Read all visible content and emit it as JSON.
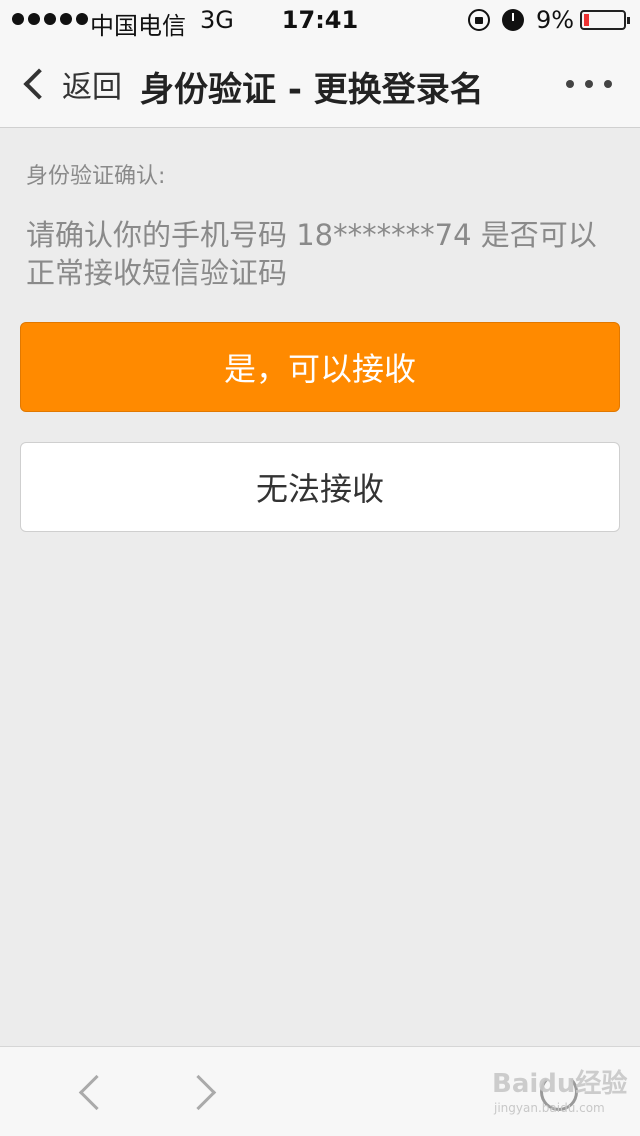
{
  "status_bar": {
    "carrier": "中国电信",
    "network": "3G",
    "time": "17:41",
    "battery_percent": "9%"
  },
  "nav": {
    "back_label": "返回",
    "title": "身份验证 - 更换登录名"
  },
  "content": {
    "label": "身份验证确认:",
    "message": "请确认你的手机号码 18*******74 是否可以正常接收短信验证码",
    "confirm_button": "是，可以接收",
    "reject_button": "无法接收"
  },
  "watermark": {
    "brand": "Baidu经验",
    "url": "jingyan.baidu.com"
  },
  "colors": {
    "accent": "#ff8a00",
    "background": "#ececec"
  }
}
